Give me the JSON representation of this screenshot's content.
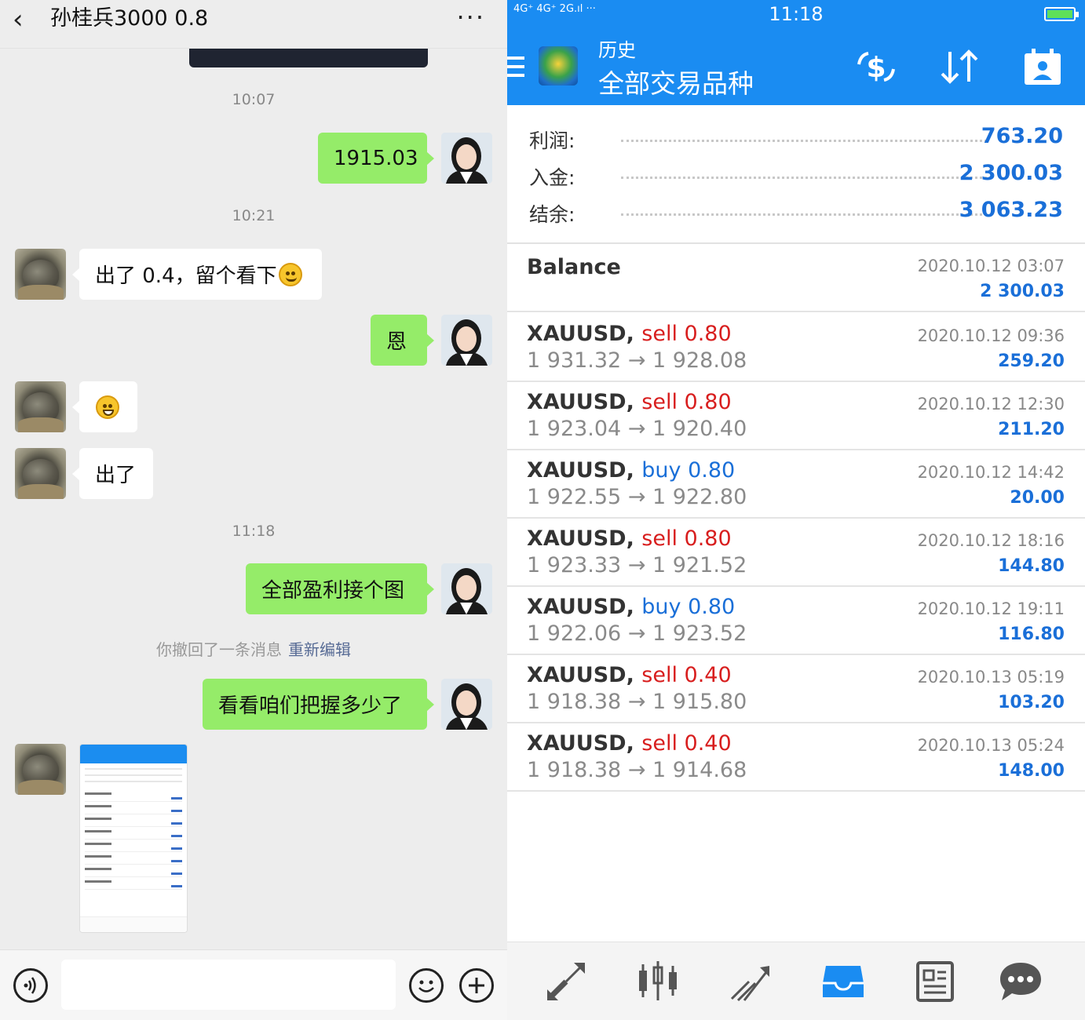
{
  "chat": {
    "title": "孙桂兵3000  0.8",
    "back_icon": "‹",
    "more_icon": "···",
    "messages": [
      {
        "type": "time",
        "text": "10:07"
      },
      {
        "type": "me",
        "text": "1915.03"
      },
      {
        "type": "time",
        "text": "10:21"
      },
      {
        "type": "other",
        "text": "出了 0.4，留个看下"
      },
      {
        "type": "me",
        "text": "恩"
      },
      {
        "type": "other_emoji",
        "text": ""
      },
      {
        "type": "other",
        "text": "出了"
      },
      {
        "type": "time",
        "text": "11:18"
      },
      {
        "type": "me",
        "text": "全部盈利接个图"
      },
      {
        "type": "recall",
        "text": "你撤回了一条消息",
        "link": "重新编辑"
      },
      {
        "type": "me",
        "text": "看看咱们把握多少了"
      },
      {
        "type": "other_image",
        "text": ""
      }
    ],
    "input_bar": {
      "voice_icon": "voice-icon",
      "emoji_icon": "emoji-icon",
      "plus_icon": "plus-icon"
    }
  },
  "mt": {
    "status": {
      "network": "4G⁺ 4G⁺ 2G.ıl ···",
      "time": "11:18",
      "battery_color": "#5fe05a"
    },
    "header": {
      "subtitle": "历史",
      "title": "全部交易品种"
    },
    "summary": [
      {
        "label": "利润:",
        "value": "763.20"
      },
      {
        "label": "入金:",
        "value": "2 300.03"
      },
      {
        "label": "结余:",
        "value": "3 063.23"
      }
    ],
    "balance": {
      "label": "Balance",
      "time": "2020.10.12 03:07",
      "value": "2 300.03"
    },
    "deals": [
      {
        "symbol": "XAUUSD,",
        "dir": "sell",
        "lot": "0.80",
        "open": "1 931.32",
        "close": "1 928.08",
        "time": "2020.10.12 09:36",
        "profit": "259.20"
      },
      {
        "symbol": "XAUUSD,",
        "dir": "sell",
        "lot": "0.80",
        "open": "1 923.04",
        "close": "1 920.40",
        "time": "2020.10.12 12:30",
        "profit": "211.20"
      },
      {
        "symbol": "XAUUSD,",
        "dir": "buy",
        "lot": "0.80",
        "open": "1 922.55",
        "close": "1 922.80",
        "time": "2020.10.12 14:42",
        "profit": "20.00"
      },
      {
        "symbol": "XAUUSD,",
        "dir": "sell",
        "lot": "0.80",
        "open": "1 923.33",
        "close": "1 921.52",
        "time": "2020.10.12 18:16",
        "profit": "144.80"
      },
      {
        "symbol": "XAUUSD,",
        "dir": "buy",
        "lot": "0.80",
        "open": "1 922.06",
        "close": "1 923.52",
        "time": "2020.10.12 19:11",
        "profit": "116.80"
      },
      {
        "symbol": "XAUUSD,",
        "dir": "sell",
        "lot": "0.40",
        "open": "1 918.38",
        "close": "1 915.80",
        "time": "2020.10.13 05:19",
        "profit": "103.20"
      },
      {
        "symbol": "XAUUSD,",
        "dir": "sell",
        "lot": "0.40",
        "open": "1 918.38",
        "close": "1 914.68",
        "time": "2020.10.13 05:24",
        "profit": "148.00"
      }
    ],
    "arrow": "→",
    "colors": {
      "accent": "#1a8cf2",
      "sell": "#d81e1e",
      "buy": "#1a6fd8"
    }
  }
}
